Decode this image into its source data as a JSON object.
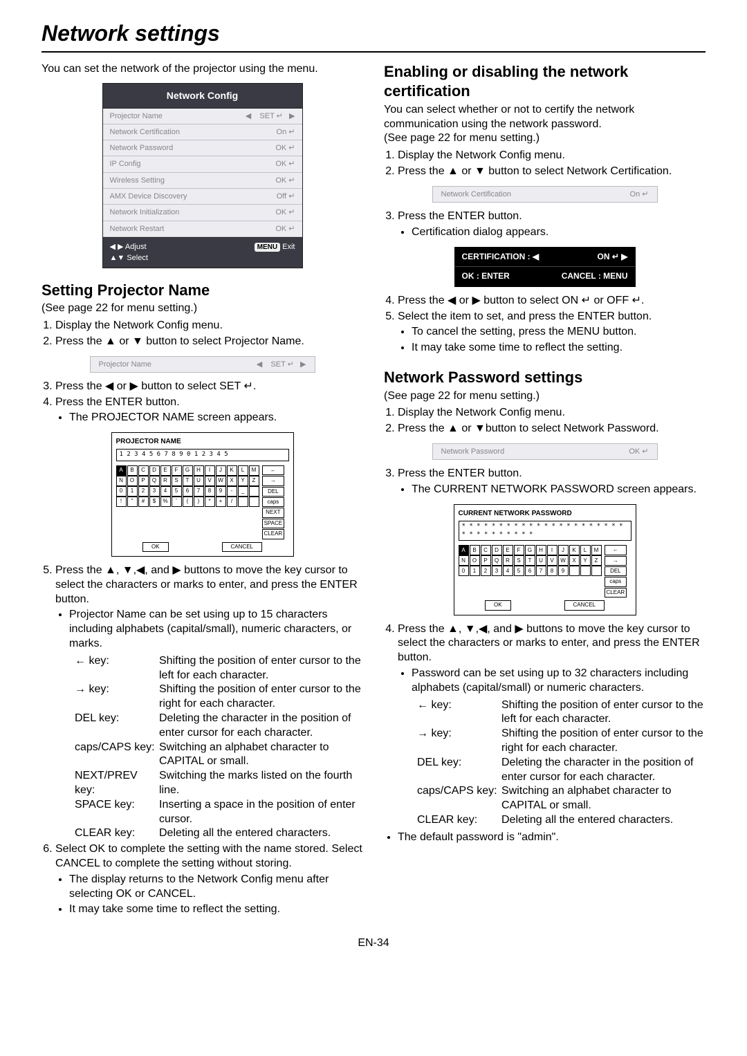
{
  "page_title": "Network settings",
  "intro": "You can set the network of the projector using the menu.",
  "page_footer": "EN-34",
  "menu": {
    "title": "Network Config",
    "rows": [
      {
        "label": "Projector Name",
        "value": "SET ↵"
      },
      {
        "label": "Network Certification",
        "value": "On ↵"
      },
      {
        "label": "Network Password",
        "value": "OK ↵"
      },
      {
        "label": "IP Config",
        "value": "OK ↵"
      },
      {
        "label": "Wireless Setting",
        "value": "OK ↵"
      },
      {
        "label": "AMX Device Discovery",
        "value": "Off ↵"
      },
      {
        "label": "Network Initialization",
        "value": "OK ↵"
      },
      {
        "label": "Network Restart",
        "value": "OK ↵"
      }
    ],
    "footer_adjust_left": "◀ ▶ Adjust",
    "footer_adjust_right_badge": "MENU",
    "footer_adjust_right": "Exit",
    "footer_select": "▲▼ Select"
  },
  "proj": {
    "heading": "Setting Projector Name",
    "see": "(See page 22 for menu setting.)",
    "step1": "Display the Network Config menu.",
    "step2": "Press the ▲ or ▼ button to select Projector Name.",
    "inset": {
      "label": "Projector Name",
      "value": "SET ↵"
    },
    "step3": "Press the ◀ or ▶ button to select SET ↵.",
    "step4": "Press the ENTER button.",
    "step4b": "The PROJECTOR NAME screen appears.",
    "kb": {
      "title": "PROJECTOR NAME",
      "field": "1 2 3 4 5 6 7 8 9 0 1 2 3 4 5",
      "row1": [
        "A",
        "B",
        "C",
        "D",
        "E",
        "F",
        "G",
        "H",
        "I",
        "J",
        "K",
        "L",
        "M"
      ],
      "row2": [
        "N",
        "O",
        "P",
        "Q",
        "R",
        "S",
        "T",
        "U",
        "V",
        "W",
        "X",
        "Y",
        "Z"
      ],
      "row3": [
        "0",
        "1",
        "2",
        "3",
        "4",
        "5",
        "6",
        "7",
        "8",
        "9",
        "-",
        "_",
        " "
      ],
      "row4": [
        "!",
        "\"",
        "#",
        "$",
        "%",
        "'",
        "(",
        ")",
        "*",
        "+",
        "/",
        " ",
        " "
      ],
      "side": [
        "←",
        "→",
        "DEL",
        "caps",
        "NEXT",
        "SPACE",
        "CLEAR"
      ],
      "ok": "OK",
      "cancel": "CANCEL"
    },
    "step5": "Press the ▲, ▼,◀, and ▶ buttons to move the key cursor to select the characters or marks to enter, and press the ENTER button.",
    "step5b": "Projector Name can be set using up to 15 characters including alphabets (capital/small), numeric characters, or marks.",
    "keys": [
      {
        "k": "← key:",
        "d": "Shifting the position of enter cursor to the left for each character."
      },
      {
        "k": "→ key:",
        "d": "Shifting the position of enter cursor to the right for each character."
      },
      {
        "k": "DEL key:",
        "d": "Deleting the character in the position of enter cursor for each character."
      },
      {
        "k": "caps/CAPS key:",
        "d": "Switching an alphabet character to CAPITAL or small."
      },
      {
        "k": "NEXT/PREV key:",
        "d": "Switching the marks listed on the fourth line."
      },
      {
        "k": "SPACE key:",
        "d": "Inserting a space in the position of enter cursor."
      },
      {
        "k": "CLEAR key:",
        "d": "Deleting all the entered characters."
      }
    ],
    "step6": "Select OK to complete the setting with the name stored. Select CANCEL to complete the setting without storing.",
    "step6b1": "The display returns to the Network Config menu after selecting OK or CANCEL.",
    "step6b2": "It may take some time to reflect the setting."
  },
  "cert": {
    "heading": "Enabling or disabling the network certification",
    "intro1": "You can select whether or not to certify the network communication using the network password.",
    "intro2": "(See page 22 for menu setting.)",
    "step1": "Display the Network Config menu.",
    "step2": "Press the ▲ or ▼ button to select Network Certification.",
    "inset": {
      "label": "Network Certification",
      "value": "On ↵"
    },
    "step3": "Press the ENTER button.",
    "step3b": "Certification dialog appears.",
    "dialog": {
      "r1l": "CERTIFICATION :  ◀",
      "r1r": "ON ↵        ▶",
      "r2l": "OK : ENTER",
      "r2r": "CANCEL : MENU"
    },
    "step4": "Press the ◀ or ▶ button to select ON ↵ or OFF ↵.",
    "step5": "Select the item to set, and press the ENTER button.",
    "step5b1": "To cancel the setting, press the MENU button.",
    "step5b2": "It may take some time to reflect the setting."
  },
  "pw": {
    "heading": "Network Password settings",
    "see": "(See page 22 for menu setting.)",
    "step1": "Display the Network Config menu.",
    "step2": "Press the ▲ or ▼button to select Network Password.",
    "inset": {
      "label": "Network Password",
      "value": "OK ↵"
    },
    "step3": "Press the ENTER button.",
    "step3b": "The CURRENT NETWORK PASSWORD screen appears.",
    "kb": {
      "title": "CURRENT NETWORK PASSWORD",
      "field": "* * * * * * * * * * * * * * * * * * * * * * * * * * * * * * * *",
      "row1": [
        "A",
        "B",
        "C",
        "D",
        "E",
        "F",
        "G",
        "H",
        "I",
        "J",
        "K",
        "L",
        "M"
      ],
      "row2": [
        "N",
        "O",
        "P",
        "Q",
        "R",
        "S",
        "T",
        "U",
        "V",
        "W",
        "X",
        "Y",
        "Z"
      ],
      "row3": [
        "0",
        "1",
        "2",
        "3",
        "4",
        "5",
        "6",
        "7",
        "8",
        "9",
        " ",
        " ",
        " "
      ],
      "side": [
        "←",
        "→",
        "DEL",
        "caps",
        "CLEAR"
      ],
      "ok": "OK",
      "cancel": "CANCEL"
    },
    "step4": "Press the ▲, ▼,◀, and ▶ buttons to move the key cursor to select the characters or marks to enter, and press the ENTER button.",
    "step4b": "Password can be set using up to 32 characters including alphabets (capital/small) or numeric characters.",
    "keys": [
      {
        "k": "← key:",
        "d": "Shifting the position of enter cursor to the left for each character."
      },
      {
        "k": "→ key:",
        "d": "Shifting the position of enter cursor to the right for each character."
      },
      {
        "k": "DEL key:",
        "d": "Deleting the character in the position of enter cursor for each character."
      },
      {
        "k": "caps/CAPS key:",
        "d": "Switching an alphabet character to CAPITAL or small."
      },
      {
        "k": "CLEAR key:",
        "d": "Deleting all the entered characters."
      }
    ],
    "default": "The default password is \"admin\"."
  }
}
